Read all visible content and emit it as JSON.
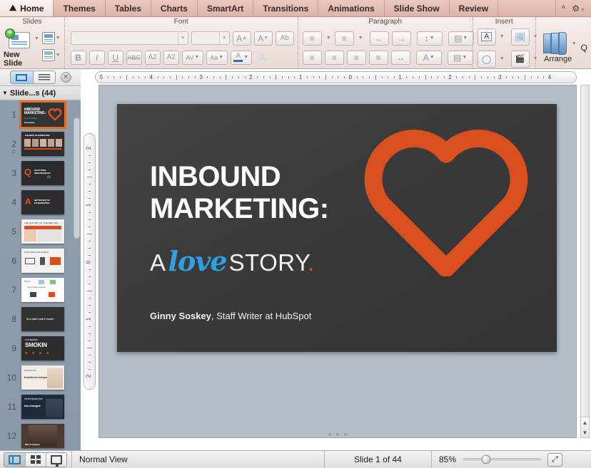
{
  "window": {
    "tabs": [
      {
        "label": "Home",
        "icon": "home-icon",
        "active": true
      },
      {
        "label": "Themes",
        "active": false
      },
      {
        "label": "Tables",
        "active": false
      },
      {
        "label": "Charts",
        "active": false
      },
      {
        "label": "SmartArt",
        "active": false
      },
      {
        "label": "Transitions",
        "active": false
      },
      {
        "label": "Animations",
        "active": false
      },
      {
        "label": "Slide Show",
        "active": false
      },
      {
        "label": "Review",
        "active": false
      }
    ],
    "collapse_icon": "chevron-up-icon",
    "settings_icon": "gear-icon"
  },
  "ribbon": {
    "groups": [
      {
        "title": "Slides"
      },
      {
        "title": "Font"
      },
      {
        "title": "Paragraph"
      },
      {
        "title": "Insert"
      }
    ],
    "new_slide_label": "New Slide",
    "arrange_label": "Arrange",
    "quick_styles_label": "Q",
    "font_name_value": "",
    "font_name_placeholder": "",
    "font_size_value": "",
    "font_size_placeholder": "",
    "buttons": {
      "grow_font": "A",
      "shrink_font": "A",
      "clear_formatting": "Ab",
      "bold": "B",
      "italic": "I",
      "underline": "U",
      "strikethrough": "ABC",
      "superscript": "A2",
      "subscript": "A2",
      "character_spacing": "AV",
      "change_case": "Aa",
      "font_color": "A",
      "highlight": "A"
    }
  },
  "slide_pane": {
    "view_toggle": {
      "slides_icon": "slides-view-icon",
      "outline_icon": "outline-view-icon",
      "close_icon": "close-icon"
    },
    "header": "Slide...s (44)",
    "thumbnails": [
      {
        "number": "1",
        "selected": true,
        "animated": false
      },
      {
        "number": "2",
        "selected": false,
        "animated": true
      },
      {
        "number": "3",
        "selected": false,
        "animated": false
      },
      {
        "number": "4",
        "selected": false,
        "animated": false
      },
      {
        "number": "5",
        "selected": false,
        "animated": false
      },
      {
        "number": "6",
        "selected": false,
        "animated": false
      },
      {
        "number": "7",
        "selected": false,
        "animated": false
      },
      {
        "number": "8",
        "selected": false,
        "animated": false
      },
      {
        "number": "9",
        "selected": false,
        "animated": false
      },
      {
        "number": "10",
        "selected": false,
        "animated": false
      },
      {
        "number": "11",
        "selected": false,
        "animated": false
      },
      {
        "number": "12",
        "selected": false,
        "animated": false
      }
    ]
  },
  "rulers": {
    "horizontal_ticks": [
      "5",
      "4",
      "3",
      "2",
      "1",
      "0",
      "1",
      "2",
      "3",
      "4"
    ],
    "vertical_ticks": [
      "2",
      "1",
      "0",
      "1",
      "2"
    ]
  },
  "slide": {
    "title_line1": "INBOUND",
    "title_line2": "MARKETING:",
    "subtitle_a": "A",
    "subtitle_love": "love",
    "subtitle_story": "STORY",
    "subtitle_period": ".",
    "byline_name": "Ginny Soskey",
    "byline_rest": ", Staff Writer at HubSpot",
    "heart_icon": "heart-icon",
    "accent_orange": "#d9501e",
    "accent_blue": "#2e9fe0",
    "background": "#3a3a3a"
  },
  "status_bar": {
    "views": [
      {
        "name": "normal-view",
        "icon": "normal-view-icon",
        "active": true
      },
      {
        "name": "slide-sorter-view",
        "icon": "slide-sorter-icon",
        "active": false
      },
      {
        "name": "presenter-view",
        "icon": "presenter-view-icon",
        "active": false
      }
    ],
    "view_label": "Normal View",
    "slide_counter": "Slide 1 of 44",
    "zoom_level": "85%",
    "fit_icon": "fit-to-window-icon"
  }
}
